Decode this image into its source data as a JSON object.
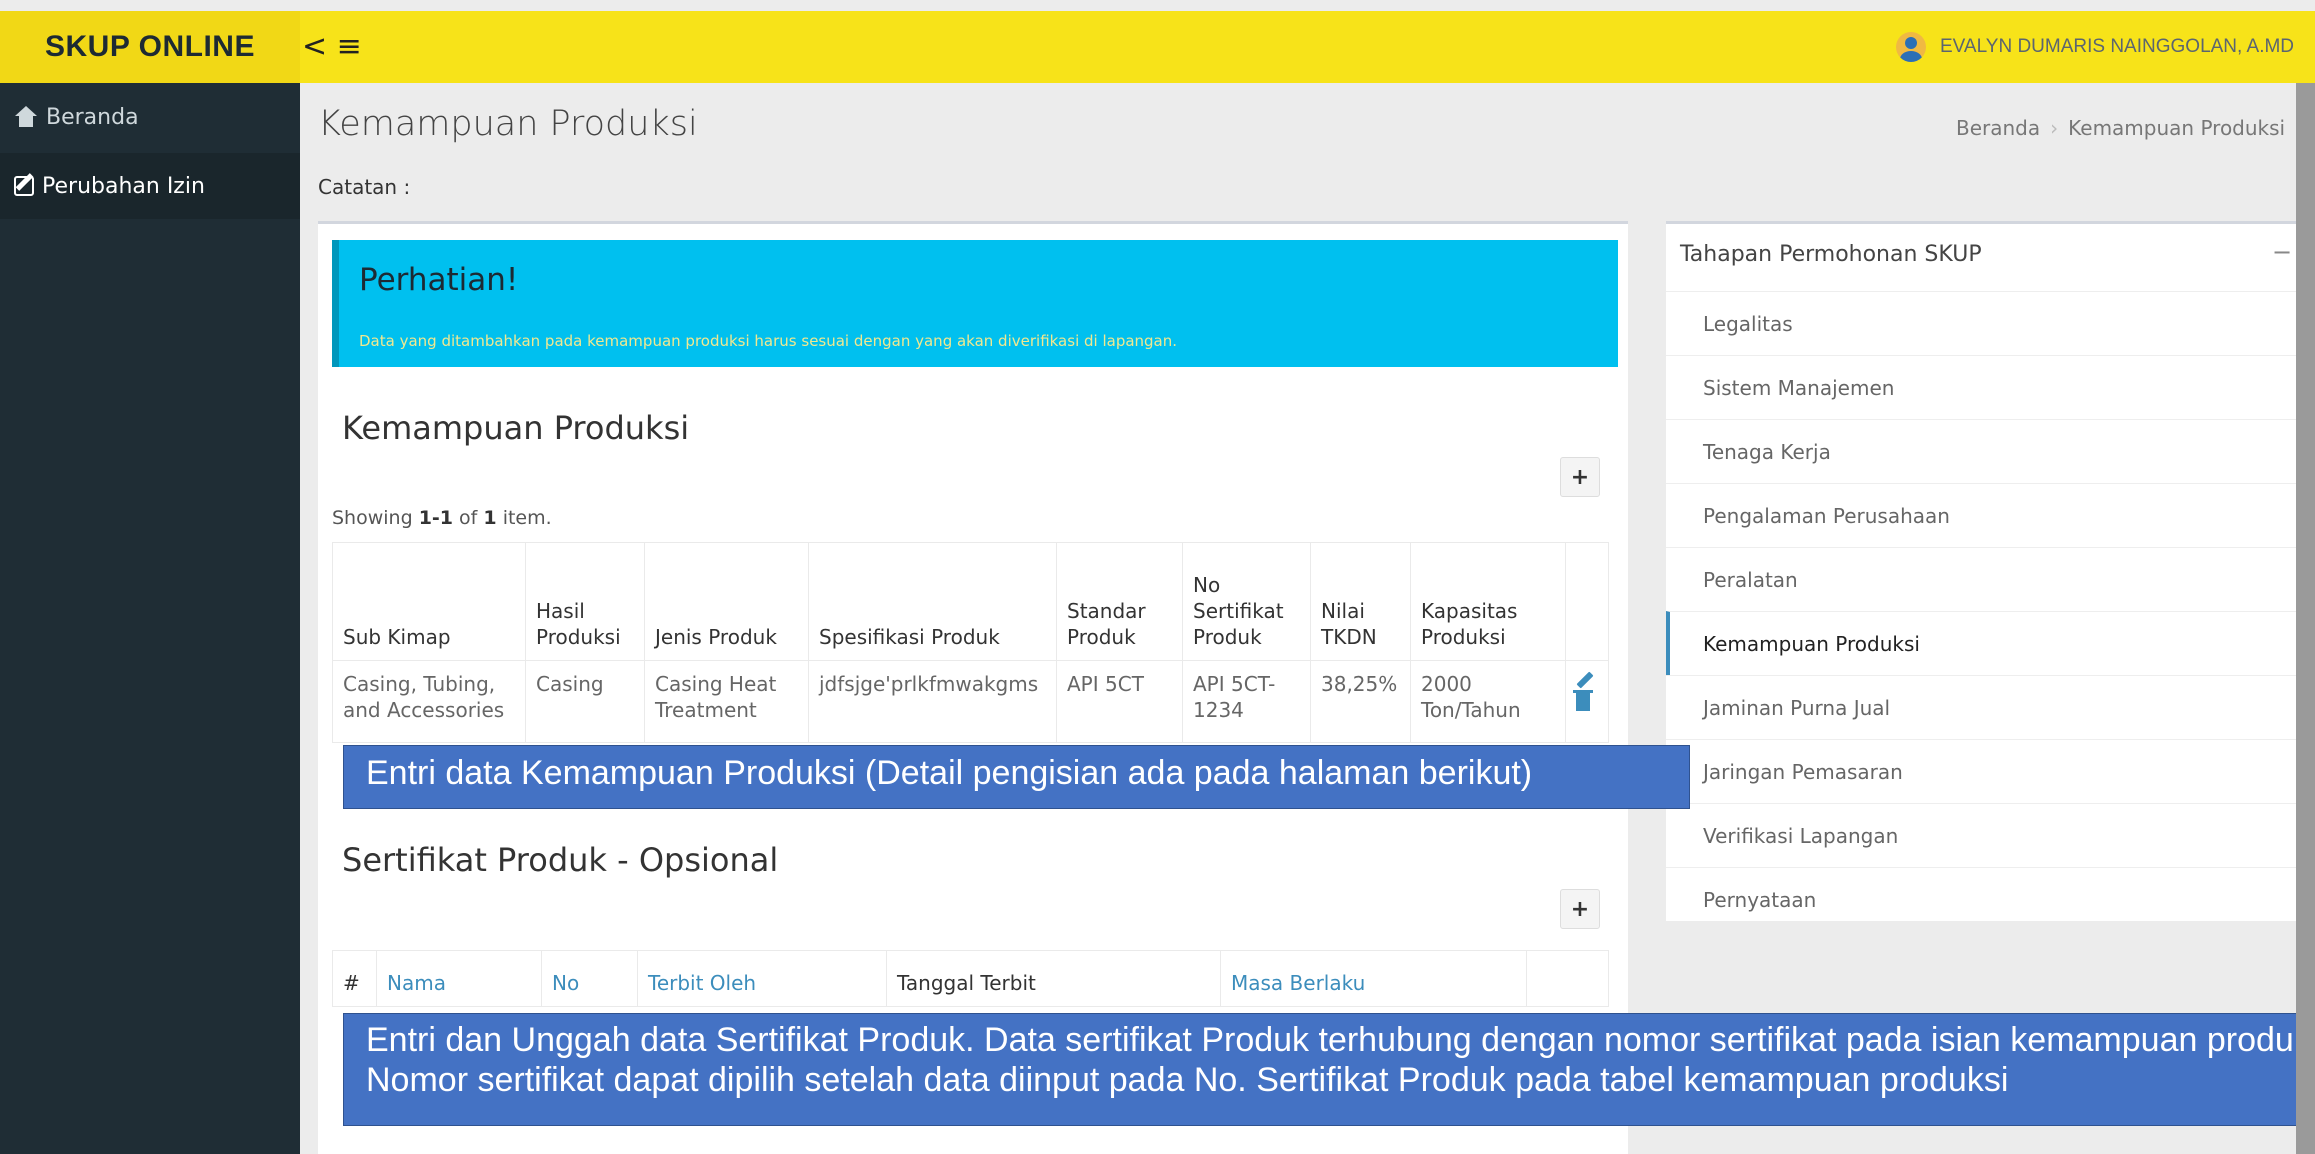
{
  "header": {
    "brand": "SKUP ONLINE",
    "toggle_label": "< ≡",
    "user_name": "EVALYN DUMARIS NAINGGOLAN, A.MD"
  },
  "sidebar": {
    "items": [
      {
        "label": "Beranda",
        "icon": "home-icon"
      },
      {
        "label": "Perubahan Izin",
        "icon": "edit-icon"
      }
    ]
  },
  "page": {
    "title": "Kemampuan Produksi",
    "catatan": "Catatan :",
    "breadcrumb": [
      "Beranda",
      "Kemampuan Produksi"
    ]
  },
  "callout": {
    "title": "Perhatian!",
    "text": "Data yang ditambahkan pada kemampuan produksi harus sesuai dengan yang akan diverifikasi di lapangan."
  },
  "kemampuan": {
    "title": "Kemampuan Produksi",
    "add_label": "+",
    "showing_prefix": "Showing ",
    "showing_range": "1-1",
    "showing_mid": " of ",
    "showing_total": "1",
    "showing_suffix": " item.",
    "columns": [
      "Sub Kimap",
      "Hasil Produksi",
      "Jenis Produk",
      "Spesifikasi Produk",
      "Standar Produk",
      "No Sertifikat Produk",
      "Nilai TKDN",
      "Kapasitas Produksi"
    ],
    "rows": [
      [
        "Casing, Tubing, and Accessories",
        "Casing",
        "Casing Heat Treatment",
        "jdfsjge'prlkfmwakgms",
        "API 5CT",
        "API 5CT-1234",
        "38,25%",
        "2000 Ton/Tahun"
      ]
    ]
  },
  "sertifikat": {
    "title": "Sertifikat Produk - Opsional",
    "add_label": "+",
    "columns": [
      "#",
      "Nama",
      "No",
      "Terbit Oleh",
      "Tanggal Terbit",
      "Masa Berlaku"
    ]
  },
  "overlays": {
    "one": "Entri data Kemampuan Produksi (Detail pengisian ada pada halaman berikut)",
    "two_line1": "Entri dan Unggah data Sertifikat Produk. Data sertifikat Produk terhubung dengan nomor sertifikat pada isian kemampuan produksi",
    "two_line2": "Nomor sertifikat dapat dipilih setelah data diinput pada No. Sertifikat Produk pada tabel kemampuan produksi"
  },
  "tahapan": {
    "title": "Tahapan Permohonan SKUP",
    "collapse_label": "−",
    "active_index": 5,
    "steps": [
      "Legalitas",
      "Sistem Manajemen",
      "Tenaga Kerja",
      "Pengalaman Perusahaan",
      "Peralatan",
      "Kemampuan Produksi",
      "Jaminan Purna Jual",
      "Jaringan Pemasaran",
      "Verifikasi Lapangan",
      "Pernyataan"
    ]
  },
  "colors": {
    "header_yellow": "#f7e319",
    "sidebar_dark": "#1f2d35",
    "callout_cyan": "#00c0ef",
    "overlay_blue": "#4472c4",
    "link_blue": "#3c8dbc"
  }
}
